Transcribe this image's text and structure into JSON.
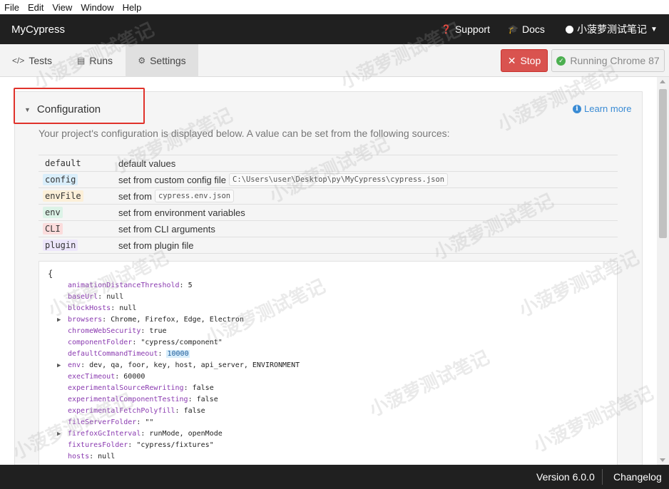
{
  "menu": [
    "File",
    "Edit",
    "View",
    "Window",
    "Help"
  ],
  "app": {
    "title": "MyCypress",
    "support_label": "Support",
    "docs_label": "Docs",
    "user_label": "小菠萝测试笔记"
  },
  "tabs": [
    {
      "label": "Tests",
      "icon": "code-icon"
    },
    {
      "label": "Runs",
      "icon": "database-icon"
    },
    {
      "label": "Settings",
      "icon": "gear-icon",
      "active": true
    }
  ],
  "toolbar": {
    "stop_label": "Stop",
    "browser_label": "Running Chrome 87"
  },
  "configuration": {
    "title": "Configuration",
    "learn_more": "Learn more",
    "description": "Your project's configuration is displayed below. A value can be set from the following sources:",
    "sources": [
      {
        "key": "default",
        "desc": "default values",
        "code": ""
      },
      {
        "key": "config",
        "desc": "set from custom config file",
        "code": "C:\\Users\\user\\Desktop\\py\\MyCypress\\cypress.json"
      },
      {
        "key": "envFile",
        "desc": "set from",
        "code": "cypress.env.json"
      },
      {
        "key": "env",
        "desc": "set from environment variables",
        "code": ""
      },
      {
        "key": "CLI",
        "desc": "set from CLI arguments",
        "code": ""
      },
      {
        "key": "plugin",
        "desc": "set from plugin file",
        "code": ""
      }
    ],
    "open_brace": "{",
    "entries": [
      {
        "key": "animationDistanceThreshold",
        "value": "5"
      },
      {
        "key": "baseUrl",
        "value": "null"
      },
      {
        "key": "blockHosts",
        "value": "null"
      },
      {
        "key": "browsers",
        "value": "Chrome, Firefox, Edge, Electron",
        "expandable": true
      },
      {
        "key": "chromeWebSecurity",
        "value": "true"
      },
      {
        "key": "componentFolder",
        "value": "\"cypress/component\""
      },
      {
        "key": "defaultCommandTimeout",
        "value": "10000",
        "highlight": true
      },
      {
        "key": "env",
        "value": "dev, qa, foor, key, host, api_server, ENVIRONMENT",
        "expandable": true
      },
      {
        "key": "execTimeout",
        "value": "60000"
      },
      {
        "key": "experimentalSourceRewriting",
        "value": "false"
      },
      {
        "key": "experimentalComponentTesting",
        "value": "false"
      },
      {
        "key": "experimentalFetchPolyfill",
        "value": "false"
      },
      {
        "key": "fileServerFolder",
        "value": "\"\""
      },
      {
        "key": "firefoxGcInterval",
        "value": "runMode, openMode",
        "expandable": true
      },
      {
        "key": "fixturesFolder",
        "value": "\"cypress/fixtures\""
      },
      {
        "key": "hosts",
        "value": "null"
      }
    ]
  },
  "footer": {
    "version": "Version 6.0.0",
    "changelog": "Changelog"
  },
  "watermark_text": "小菠萝测试笔记",
  "colors": {
    "titlebar": "#202020",
    "stop": "#d9534f",
    "link": "#3a8bd4",
    "highlight_box": "#e0322b"
  }
}
